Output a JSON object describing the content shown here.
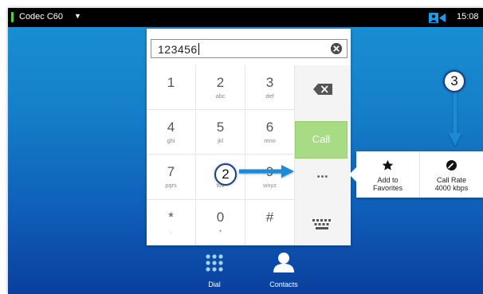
{
  "topbar": {
    "device_name": "Codec C60",
    "device_menu": "▼",
    "clock": "15:08"
  },
  "dial_field": {
    "value": "123456"
  },
  "keys": [
    {
      "digit": "1",
      "letters": ""
    },
    {
      "digit": "2",
      "letters": "abc"
    },
    {
      "digit": "3",
      "letters": "def"
    },
    {
      "digit": "4",
      "letters": "ghi"
    },
    {
      "digit": "5",
      "letters": "jkl"
    },
    {
      "digit": "6",
      "letters": "mno"
    },
    {
      "digit": "7",
      "letters": "pqrs"
    },
    {
      "digit": "8",
      "letters": "tuv"
    },
    {
      "digit": "9",
      "letters": "wxyz"
    },
    {
      "digit": "*",
      "letters": "."
    },
    {
      "digit": "0",
      "letters": "+"
    },
    {
      "digit": "#",
      "letters": ""
    }
  ],
  "call_button": {
    "label": "Call"
  },
  "more_button": {
    "label": "•••"
  },
  "popup": {
    "add_favorites": {
      "line1": "Add to",
      "line2": "Favorites"
    },
    "call_rate": {
      "line1": "Call Rate",
      "line2": "4000 kbps"
    }
  },
  "bottom_nav": {
    "dial": "Dial",
    "contacts": "Contacts"
  },
  "annotations": {
    "marker_2": "2",
    "marker_3": "3"
  },
  "colors": {
    "accent": "#1a91d4",
    "call_green": "#a7db84",
    "arrow": "#1c8ad6",
    "topbar": "#000000"
  }
}
